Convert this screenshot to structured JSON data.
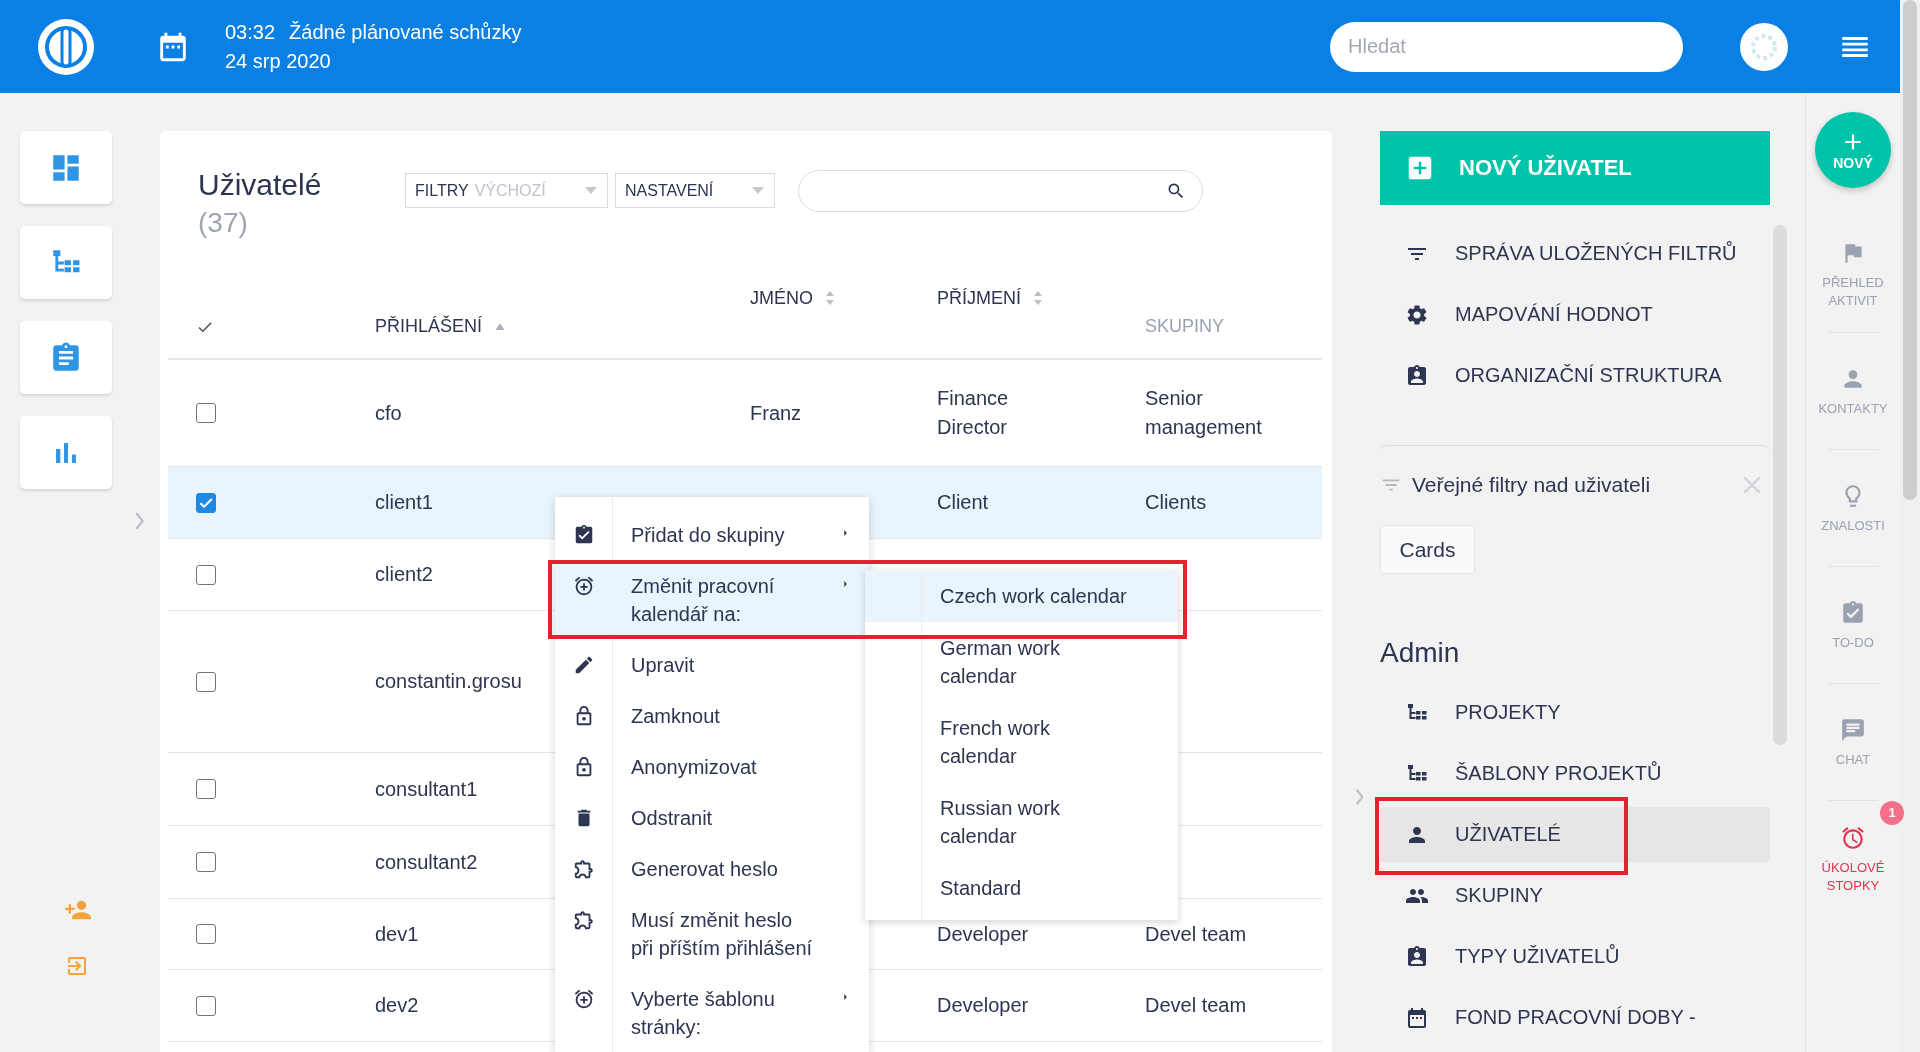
{
  "header": {
    "time": "03:32",
    "meetings": "Žádné plánované schůzky",
    "date": "24 srp 2020",
    "search": {
      "placeholder": "Hledat"
    }
  },
  "users": {
    "title": "Uživatelé",
    "count": "(37)",
    "filter_button": {
      "label": "FILTRY",
      "value": "VÝCHOZÍ"
    },
    "settings_button": {
      "label": "NASTAVENÍ"
    },
    "table": {
      "columns": [
        {
          "label": "PŘIHLÁŠENÍ",
          "sortable": true,
          "sorted": true
        },
        {
          "label": "JMÉNO",
          "sortable": true,
          "sorted": false
        },
        {
          "label": "PŘÍJMENÍ",
          "sortable": true,
          "sorted": false
        },
        {
          "label": "SKUPINY",
          "sortable": false
        }
      ],
      "rows": [
        {
          "selected": false,
          "login": "cfo",
          "first_name": "Franz",
          "last_name": "Finance Director",
          "groups": "Senior management"
        },
        {
          "selected": true,
          "login": "client1",
          "last_name": "Client",
          "groups": "Clients"
        },
        {
          "selected": false,
          "login": "client2"
        },
        {
          "selected": false,
          "login": "constantin.grosu"
        },
        {
          "selected": false,
          "login": "consultant1"
        },
        {
          "selected": false,
          "login": "consultant2"
        },
        {
          "selected": false,
          "login": "dev1",
          "last_name": "Developer",
          "groups": "Devel team"
        },
        {
          "selected": false,
          "login": "dev2",
          "last_name": "Developer",
          "groups": "Devel team"
        }
      ]
    },
    "context_menu": {
      "items": [
        {
          "label": "Přidat do skupiny",
          "submenu": true,
          "selected": false,
          "highlighted": false
        },
        {
          "label": "Změnit pracovní kalendář na:",
          "submenu": true,
          "selected": true,
          "highlighted": true
        },
        {
          "label": "Upravit",
          "submenu": false,
          "selected": false,
          "highlighted": false
        },
        {
          "label": "Zamknout",
          "submenu": false,
          "selected": false,
          "highlighted": false
        },
        {
          "label": "Anonymizovat",
          "submenu": false,
          "selected": false,
          "highlighted": false
        },
        {
          "label": "Odstranit",
          "submenu": false,
          "selected": false,
          "highlighted": false
        },
        {
          "label": "Generovat heslo",
          "submenu": false,
          "selected": false,
          "highlighted": false
        },
        {
          "label": "Musí změnit heslo při příštím přihlášení",
          "submenu": false,
          "selected": false,
          "highlighted": false
        },
        {
          "label": "Vyberte šablonu stránky:",
          "submenu": true,
          "selected": false,
          "highlighted": false
        }
      ]
    },
    "submenu": {
      "items": [
        {
          "label": "Czech work calendar",
          "selected": true
        },
        {
          "label": "German work calendar",
          "selected": false
        },
        {
          "label": "French work calendar",
          "selected": false
        },
        {
          "label": "Russian work calendar",
          "selected": false
        },
        {
          "label": "Standard",
          "selected": false
        }
      ]
    }
  },
  "right_panel": {
    "new_button": "NOVÝ UŽIVATEL",
    "actions": [
      "SPRÁVA ULOŽENÝCH FILTRŮ",
      "MAPOVÁNÍ HODNOT",
      "ORGANIZAČNÍ STRUKTURA"
    ],
    "public_filters": {
      "title": "Veřejné filtry nad uživateli",
      "chips": [
        "Cards"
      ]
    },
    "admin": {
      "title": "Admin",
      "items": [
        {
          "label": "PROJEKTY",
          "selected": false,
          "highlighted": false
        },
        {
          "label": "ŠABLONY PROJEKTŮ",
          "selected": false,
          "highlighted": false
        },
        {
          "label": "UŽIVATELÉ",
          "selected": true,
          "highlighted": true
        },
        {
          "label": "SKUPINY",
          "selected": false,
          "highlighted": false
        },
        {
          "label": "TYPY UŽIVATELŮ",
          "selected": false,
          "highlighted": false
        },
        {
          "label": "FOND PRACOVNÍ DOBY -",
          "selected": false,
          "highlighted": false
        }
      ]
    }
  },
  "dock": {
    "new_button": "NOVÝ",
    "items": [
      {
        "label": "PŘEHLED AKTIVIT",
        "alert": false
      },
      {
        "label": "KONTAKTY",
        "alert": false
      },
      {
        "label": "ZNALOSTI",
        "alert": false
      },
      {
        "label": "TO-DO",
        "alert": false
      },
      {
        "label": "CHAT",
        "alert": false
      },
      {
        "label": "ÚKOLOVÉ STOPKY",
        "alert": true,
        "badge": "1"
      }
    ]
  }
}
